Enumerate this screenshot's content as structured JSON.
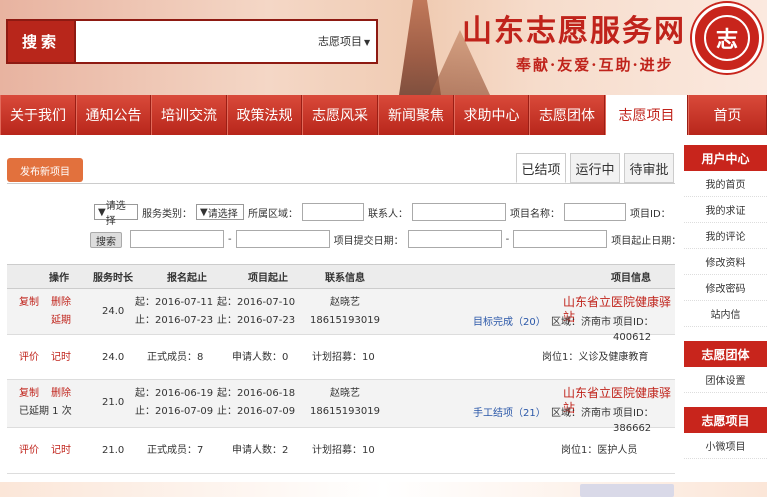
{
  "header": {
    "search_button": "搜索",
    "search_type": "志愿项目",
    "site_title": "山东志愿服务网",
    "slogan": "奉献·友爱·互助·进步",
    "logo_char": "志"
  },
  "nav": {
    "items": [
      "关于我们",
      "通知公告",
      "培训交流",
      "政策法规",
      "志愿风采",
      "新闻聚焦",
      "求助中心",
      "志愿团体",
      "志愿项目",
      "首页"
    ]
  },
  "sidebar": {
    "user_center": "用户中心",
    "user_items": [
      "我的首页",
      "我的求证",
      "我的评论",
      "修改资料",
      "修改密码",
      "站内信"
    ],
    "group_head": "志愿团体",
    "group_items": [
      "团体设置"
    ],
    "project_head": "志愿项目",
    "project_items": [
      "小微项目"
    ]
  },
  "content": {
    "publish_button": "发布新项目",
    "tabs": [
      "已结项",
      "运行中",
      "待审批"
    ],
    "filters": {
      "project_id": "项目ID：",
      "project_name": "项目名称：",
      "contact": "联系人：",
      "region": "所属区域：",
      "region_select": "请选择",
      "service_type": "服务类别：",
      "service_select": "请选择",
      "start_date": "项目起止日期：",
      "submit_date": "项目提交日期：",
      "dash": "-",
      "query_button": "搜索"
    },
    "table": {
      "headers": [
        "项目信息",
        "联系信息",
        "项目起止",
        "报名起止",
        "服务时长",
        "操作"
      ],
      "rows": [
        {
          "title": "山东省立医院健康驿站",
          "id": "项目ID：400612",
          "region": "区域：济南市",
          "status": "目标完成（20）",
          "contact_name": "赵晓艺",
          "contact_phone": "18615193019",
          "proj_start": "起：2016-07-10",
          "proj_end": "止：2016-07-23",
          "sign_start": "起：2016-07-11",
          "sign_end": "止：2016-07-23",
          "hours": "24.0",
          "actions": [
            "复制",
            "删除",
            "延期"
          ],
          "sub": {
            "post": "岗位1：义诊及健康教育",
            "plan": "计划招募：10",
            "apply": "申请人数：0",
            "member": "正式成员：8",
            "hours": "24.0",
            "actions": [
              "评价",
              "记时"
            ]
          }
        },
        {
          "title": "山东省立医院健康驿站",
          "id": "项目ID：386662",
          "region": "区域：济南市",
          "status": "手工结项（21）",
          "contact_name": "赵晓艺",
          "contact_phone": "18615193019",
          "proj_start": "起：2016-06-18",
          "proj_end": "止：2016-07-09",
          "sign_start": "起：2016-06-19",
          "sign_end": "止：2016-07-09",
          "hours": "21.0",
          "actions": [
            "复制",
            "删除",
            "已延期 1 次"
          ],
          "sub": {
            "post": "岗位1：医护人员",
            "plan": "计划招募：10",
            "apply": "申请人数：2",
            "member": "正式成员：7",
            "hours": "21.0",
            "actions": [
              "评价",
              "记时"
            ]
          }
        }
      ]
    }
  }
}
